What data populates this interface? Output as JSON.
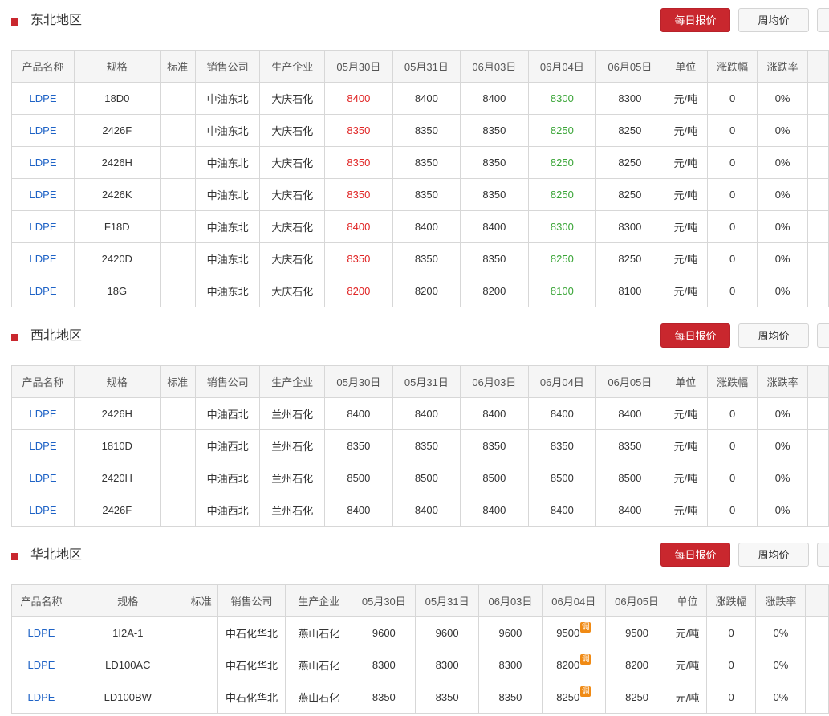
{
  "buttons": {
    "daily": "每日报价",
    "weekly": "周均价"
  },
  "headers": [
    "产品名称",
    "规格",
    "标准",
    "销售公司",
    "生产企业",
    "05月30日",
    "05月31日",
    "06月03日",
    "06月04日",
    "06月05日",
    "单位",
    "涨跌幅",
    "涨跌率"
  ],
  "adjust_icon_label": "调",
  "colors": {
    "accent": "#c9272e",
    "up": "#e02424",
    "down": "#3aa537",
    "link": "#1f63c6",
    "adjust": "#f08a14"
  },
  "sections": [
    {
      "title": "东北地区",
      "rows": [
        {
          "product": "LDPE",
          "spec": "18D0",
          "standard": "",
          "seller": "中油东北",
          "producer": "大庆石化",
          "p1": "8400",
          "p2": "8400",
          "p3": "8400",
          "p4": "8300",
          "p5": "8300",
          "unit": "元/吨",
          "change": "0",
          "rate": "0%",
          "c1": "up",
          "c4": "down",
          "adj": false
        },
        {
          "product": "LDPE",
          "spec": "2426F",
          "standard": "",
          "seller": "中油东北",
          "producer": "大庆石化",
          "p1": "8350",
          "p2": "8350",
          "p3": "8350",
          "p4": "8250",
          "p5": "8250",
          "unit": "元/吨",
          "change": "0",
          "rate": "0%",
          "c1": "up",
          "c4": "down",
          "adj": false
        },
        {
          "product": "LDPE",
          "spec": "2426H",
          "standard": "",
          "seller": "中油东北",
          "producer": "大庆石化",
          "p1": "8350",
          "p2": "8350",
          "p3": "8350",
          "p4": "8250",
          "p5": "8250",
          "unit": "元/吨",
          "change": "0",
          "rate": "0%",
          "c1": "up",
          "c4": "down",
          "adj": false
        },
        {
          "product": "LDPE",
          "spec": "2426K",
          "standard": "",
          "seller": "中油东北",
          "producer": "大庆石化",
          "p1": "8350",
          "p2": "8350",
          "p3": "8350",
          "p4": "8250",
          "p5": "8250",
          "unit": "元/吨",
          "change": "0",
          "rate": "0%",
          "c1": "up",
          "c4": "down",
          "adj": false
        },
        {
          "product": "LDPE",
          "spec": "F18D",
          "standard": "",
          "seller": "中油东北",
          "producer": "大庆石化",
          "p1": "8400",
          "p2": "8400",
          "p3": "8400",
          "p4": "8300",
          "p5": "8300",
          "unit": "元/吨",
          "change": "0",
          "rate": "0%",
          "c1": "up",
          "c4": "down",
          "adj": false
        },
        {
          "product": "LDPE",
          "spec": "2420D",
          "standard": "",
          "seller": "中油东北",
          "producer": "大庆石化",
          "p1": "8350",
          "p2": "8350",
          "p3": "8350",
          "p4": "8250",
          "p5": "8250",
          "unit": "元/吨",
          "change": "0",
          "rate": "0%",
          "c1": "up",
          "c4": "down",
          "adj": false
        },
        {
          "product": "LDPE",
          "spec": "18G",
          "standard": "",
          "seller": "中油东北",
          "producer": "大庆石化",
          "p1": "8200",
          "p2": "8200",
          "p3": "8200",
          "p4": "8100",
          "p5": "8100",
          "unit": "元/吨",
          "change": "0",
          "rate": "0%",
          "c1": "up",
          "c4": "down",
          "adj": false
        }
      ]
    },
    {
      "title": "西北地区",
      "rows": [
        {
          "product": "LDPE",
          "spec": "2426H",
          "standard": "",
          "seller": "中油西北",
          "producer": "兰州石化",
          "p1": "8400",
          "p2": "8400",
          "p3": "8400",
          "p4": "8400",
          "p5": "8400",
          "unit": "元/吨",
          "change": "0",
          "rate": "0%",
          "c1": "",
          "c4": "",
          "adj": false
        },
        {
          "product": "LDPE",
          "spec": "1810D",
          "standard": "",
          "seller": "中油西北",
          "producer": "兰州石化",
          "p1": "8350",
          "p2": "8350",
          "p3": "8350",
          "p4": "8350",
          "p5": "8350",
          "unit": "元/吨",
          "change": "0",
          "rate": "0%",
          "c1": "",
          "c4": "",
          "adj": false
        },
        {
          "product": "LDPE",
          "spec": "2420H",
          "standard": "",
          "seller": "中油西北",
          "producer": "兰州石化",
          "p1": "8500",
          "p2": "8500",
          "p3": "8500",
          "p4": "8500",
          "p5": "8500",
          "unit": "元/吨",
          "change": "0",
          "rate": "0%",
          "c1": "",
          "c4": "",
          "adj": false
        },
        {
          "product": "LDPE",
          "spec": "2426F",
          "standard": "",
          "seller": "中油西北",
          "producer": "兰州石化",
          "p1": "8400",
          "p2": "8400",
          "p3": "8400",
          "p4": "8400",
          "p5": "8400",
          "unit": "元/吨",
          "change": "0",
          "rate": "0%",
          "c1": "",
          "c4": "",
          "adj": false
        }
      ]
    },
    {
      "title": "华北地区",
      "rows": [
        {
          "product": "LDPE",
          "spec": "1I2A-1",
          "standard": "",
          "seller": "中石化华北",
          "producer": "燕山石化",
          "p1": "9600",
          "p2": "9600",
          "p3": "9600",
          "p4": "9500",
          "p5": "9500",
          "unit": "元/吨",
          "change": "0",
          "rate": "0%",
          "c1": "",
          "c4": "",
          "adj": true
        },
        {
          "product": "LDPE",
          "spec": "LD100AC",
          "standard": "",
          "seller": "中石化华北",
          "producer": "燕山石化",
          "p1": "8300",
          "p2": "8300",
          "p3": "8300",
          "p4": "8200",
          "p5": "8200",
          "unit": "元/吨",
          "change": "0",
          "rate": "0%",
          "c1": "",
          "c4": "",
          "adj": true
        },
        {
          "product": "LDPE",
          "spec": "LD100BW",
          "standard": "",
          "seller": "中石化华北",
          "producer": "燕山石化",
          "p1": "8350",
          "p2": "8350",
          "p3": "8350",
          "p4": "8250",
          "p5": "8250",
          "unit": "元/吨",
          "change": "0",
          "rate": "0%",
          "c1": "",
          "c4": "",
          "adj": true
        }
      ]
    }
  ]
}
